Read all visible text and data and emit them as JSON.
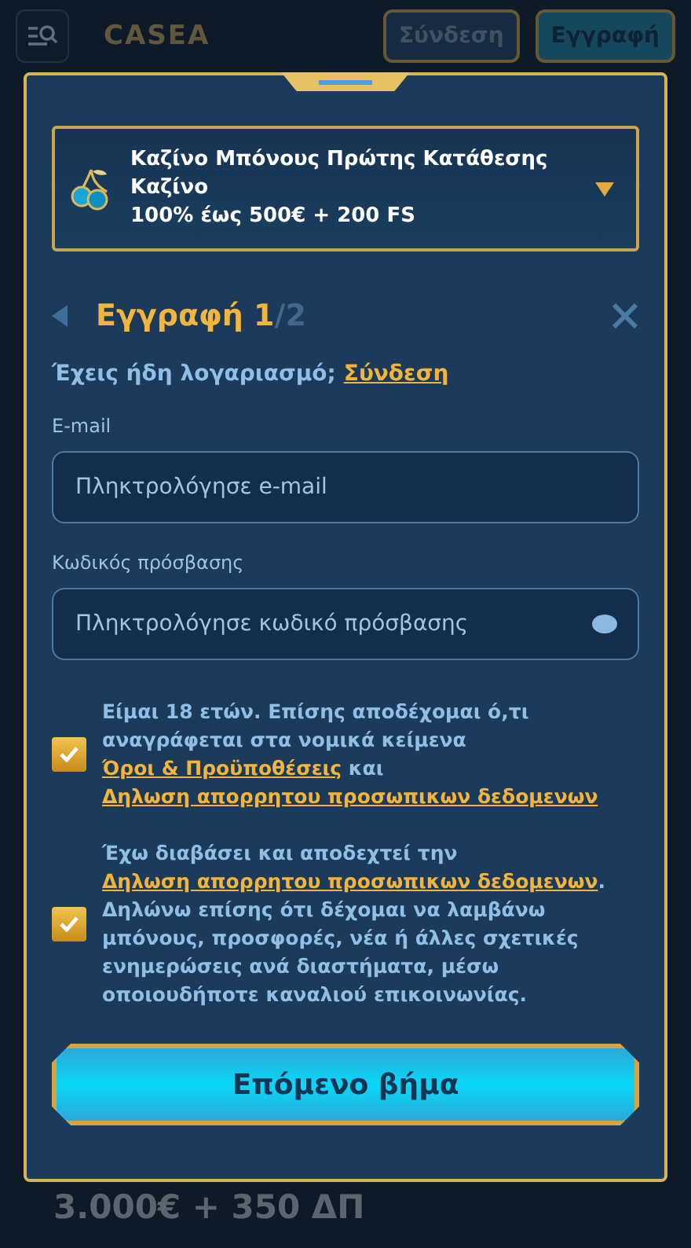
{
  "header": {
    "logo": "CASEA",
    "buttons": [
      {
        "label": "Σύνδεση",
        "kind": "login"
      },
      {
        "label": "Εγγραφή",
        "kind": "register"
      }
    ]
  },
  "modal": {
    "bonus": {
      "title": "Καζίνο Μπόνους Πρώτης Κατάθεσης Καζίνο",
      "offer": "100% έως 500€ + 200 FS",
      "expanded": false
    },
    "title": "Εγγραφή",
    "step": "1",
    "total": "/2",
    "have_account": {
      "text": "Έχεις ήδη λογαριασμό;",
      "link": "Σύνδεση"
    },
    "fields": [
      {
        "label": "E-mail",
        "placeholder": "Πληκτρολόγησε e-mail",
        "kind": "email"
      },
      {
        "label": "Κωδικός πρόσβασης",
        "placeholder": "Πληκτρολόγησε κωδικό πρόσβασης",
        "kind": "password"
      }
    ],
    "consents": [
      {
        "checked": true,
        "parts": [
          {
            "kind": "text",
            "text": "Είμαι 18 ετών. Επίσης αποδέχομαι ό,τι αναγράφεται στα νομικά κείμενα "
          },
          {
            "kind": "link",
            "text": "Όροι & Προϋποθέσεις"
          },
          {
            "kind": "text",
            "text": " και "
          },
          {
            "kind": "link",
            "text": "Δηλωση απορρητου προσωπικων δεδομενων"
          }
        ]
      },
      {
        "checked": true,
        "parts": [
          {
            "kind": "text",
            "text": "Έχω διαβάσει και αποδεχτεί την "
          },
          {
            "kind": "link",
            "text": "Δηλωση απορρητου προσωπικων δεδομενων"
          },
          {
            "kind": "text",
            "text": ". Δηλώνω επίσης ότι δέχομαι να λαμβάνω μπόνους, προσφορές, νέα ή άλλες σχετικές ενημερώσεις ανά διαστήματα, μέσω οποιουδήποτε καναλιού επικοινωνίας."
          }
        ]
      }
    ],
    "next_button": "Επόμενο βήμα"
  },
  "background_promo": [
    "3.000€ + 350 ΔΠ"
  ]
}
